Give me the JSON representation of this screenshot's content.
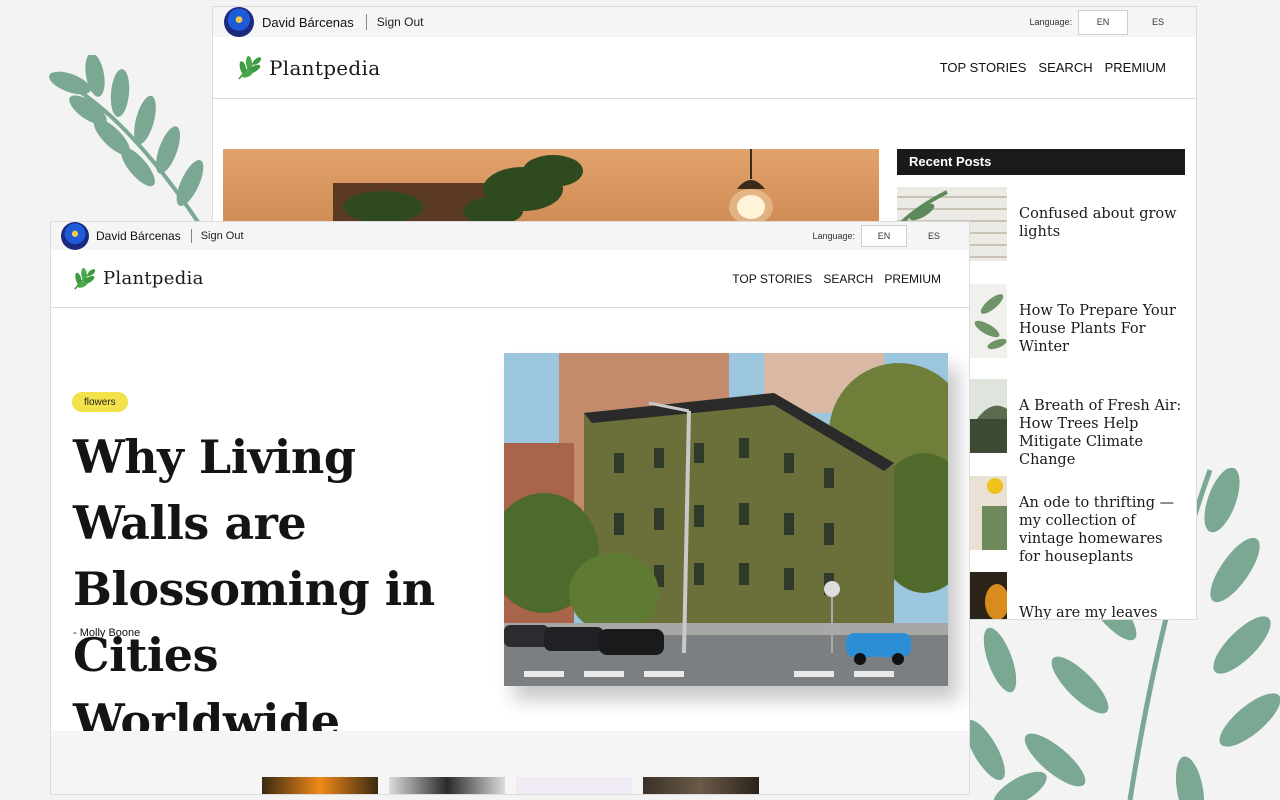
{
  "back_window": {
    "user": {
      "name": "David Bárcenas",
      "sign_out": "Sign Out"
    },
    "language": {
      "label": "Language:",
      "options": [
        "EN",
        "ES"
      ],
      "selected": "EN"
    },
    "logo": "Plantpedia",
    "nav": [
      "TOP STORIES",
      "SEARCH",
      "PREMIUM"
    ],
    "recent_posts": {
      "heading": "Recent Posts",
      "items": [
        {
          "title": "Confused about grow lights"
        },
        {
          "title": "How To Prepare Your House Plants For Winter"
        },
        {
          "title": "A Breath of Fresh Air: How Trees Help Mitigate Climate Change"
        },
        {
          "title": "An ode to thrifting — my collection of vintage homewares for houseplants"
        },
        {
          "title": "Why are my leaves turning yellow?"
        }
      ]
    }
  },
  "front_window": {
    "user": {
      "name": "David Bárcenas",
      "sign_out": "Sign Out"
    },
    "language": {
      "label": "Language:",
      "options": [
        "EN",
        "ES"
      ],
      "selected": "EN"
    },
    "logo": "Plantpedia",
    "nav": [
      "TOP STORIES",
      "SEARCH",
      "PREMIUM"
    ],
    "article": {
      "tag": "flowers",
      "title": "Why Living Walls are Blossoming in Cities Worldwide",
      "author": "- Molly Boone"
    }
  },
  "colors": {
    "tag_yellow": "#f3e24a",
    "recent_posts_header": "#1a1a1a",
    "leaf_green": "#7ba893",
    "logo_leaf": "#3f9a3f"
  }
}
